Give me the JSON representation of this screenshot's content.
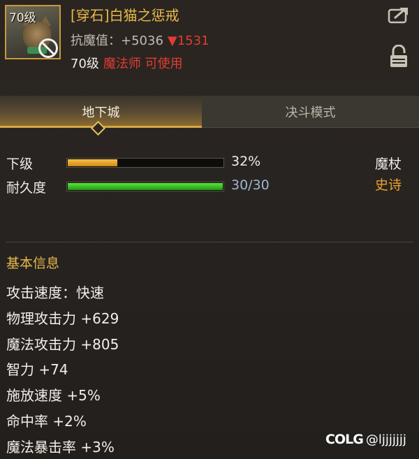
{
  "item": {
    "icon_level": "70级",
    "icon_name": "cat-portrait-icon",
    "title": "[穿石]白猫之惩戒",
    "stat_label": "抗魔值：",
    "stat_value": "+5036",
    "stat_diff": "▼1531",
    "req_level": "70级",
    "req_class": "魔法师 可使用"
  },
  "tabs": [
    {
      "label": "地下城",
      "active": true
    },
    {
      "label": "决斗模式",
      "active": false
    }
  ],
  "status": {
    "grade_label": "下级",
    "grade_pct": "32%",
    "grade_value": 0.32,
    "durability_label": "耐久度",
    "durability_value": "30/30",
    "durability_fraction": 1.0,
    "weapon_type": "魔杖",
    "rarity": "史诗"
  },
  "basic_info": {
    "title": "基本信息",
    "attributes": [
      "攻击速度：快速",
      "物理攻击力 +629",
      "魔法攻击力 +805",
      "智力 +74",
      "施放速度 +5%",
      "命中率 +2%",
      "魔法暴击率 +3%"
    ]
  },
  "watermark": {
    "logo": "COLG",
    "user": "@ljjjjjjj"
  },
  "colors": {
    "gold": "#e8b84a",
    "red": "#e03c34",
    "epic": "#e8a030",
    "durability_blue": "#9fb6d2"
  }
}
